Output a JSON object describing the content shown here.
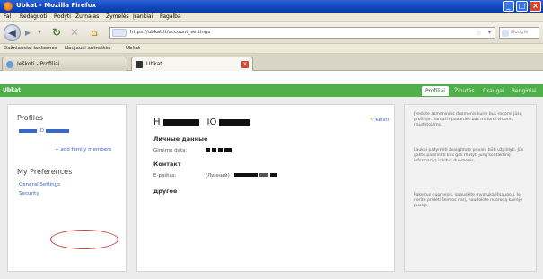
{
  "browser": {
    "window_title": "Ubkat - Mozilla Firefox",
    "menu": [
      "Fal",
      "Redaguoti",
      "Rodyti",
      "Žurnalas",
      "Žymelės",
      "Įrankiai",
      "Pagalba"
    ],
    "url": "https://ubkat.lt/account_settings",
    "search_placeholder": "Google",
    "bookmarks": [
      "Dažniausiai lankomos",
      "Naujausi antraštės",
      "Ubkat"
    ],
    "tabs": [
      {
        "label": "Ieškoti - Profiliai"
      },
      {
        "label": "Ubkat"
      }
    ]
  },
  "site": {
    "brand": "Ubkat",
    "nav": [
      "Profiliai",
      "Žinutės",
      "Draugai",
      "Renginiai"
    ],
    "active_nav_index": 0
  },
  "sidebar": {
    "profiles_title": "Profiles",
    "profile_link": "H... IO...",
    "add_link": "+ add family members",
    "prefs_title": "My Preferences",
    "pref_links": [
      "General Settings",
      "Security"
    ]
  },
  "profile": {
    "name": "H... IO...",
    "edit_label": "Keisti",
    "personal_title": "Личные данные",
    "birth_label": "Gimimo data:",
    "contacts_title": "Контакт",
    "email_label": "E-paštas:",
    "email_type": "(Личный)",
    "other_title": "другое"
  },
  "help": {
    "paragraphs": [
      "Įveskite asmeninius duomenis kurie bus rodomi jūsų profilyje. Vardai ir pavardės bus matomi visiems naudotojams.",
      "Laukai pažymėti žvaigždute privalo būti užpildyti. Jūs galite pasirinkti kas gali matyti jūsų kontaktinę informaciją ir kitus duomenis.",
      "Pakeitus duomenis, spauskite mygtuką Išsaugoti. Jei norite pridėti šeimos narį, naudokite nuorodą kairėje pusėje."
    ]
  },
  "colors": {
    "site_green": "#4fb04a",
    "link_blue": "#3a66c4",
    "annotation_red": "#c93b3b",
    "titlebar_blue": "#0f46b8"
  }
}
